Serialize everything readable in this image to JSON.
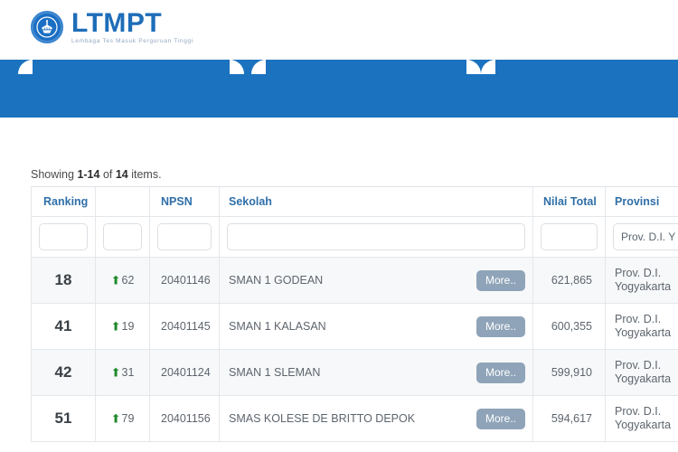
{
  "brand": {
    "name": "LTMPT",
    "tagline": "Lembaga Tes Masuk Perguruan Tinggi",
    "logo_icon": "university-emblem-icon",
    "accent_color": "#1e6db8",
    "navbar_color": "#1b72bf"
  },
  "summary": {
    "prefix": "Showing ",
    "range": "1-14",
    "middle": " of ",
    "total": "14",
    "suffix": " items."
  },
  "table": {
    "columns": [
      {
        "key": "ranking",
        "label": "Ranking"
      },
      {
        "key": "delta",
        "label": ""
      },
      {
        "key": "npsn",
        "label": "NPSN"
      },
      {
        "key": "sekolah",
        "label": "Sekolah"
      },
      {
        "key": "nilai_total",
        "label": "Nilai Total"
      },
      {
        "key": "provinsi",
        "label": "Provinsi"
      }
    ],
    "filters": {
      "ranking": "",
      "delta": "",
      "npsn": "",
      "sekolah": "",
      "nilai_total": "",
      "provinsi": "Prov. D.I. Y"
    },
    "more_label": "More..",
    "delta_icon": "arrow-up-icon",
    "delta_color": "#1d8a2b",
    "rows": [
      {
        "ranking": "18",
        "delta": "62",
        "npsn": "20401146",
        "sekolah": "SMAN 1 GODEAN",
        "nilai_total": "621,865",
        "prov_line1": "Prov. D.I.",
        "prov_line2": "Yogyakarta"
      },
      {
        "ranking": "41",
        "delta": "19",
        "npsn": "20401145",
        "sekolah": "SMAN 1 KALASAN",
        "nilai_total": "600,355",
        "prov_line1": "Prov. D.I.",
        "prov_line2": "Yogyakarta"
      },
      {
        "ranking": "42",
        "delta": "31",
        "npsn": "20401124",
        "sekolah": "SMAN 1 SLEMAN",
        "nilai_total": "599,910",
        "prov_line1": "Prov. D.I.",
        "prov_line2": "Yogyakarta"
      },
      {
        "ranking": "51",
        "delta": "79",
        "npsn": "20401156",
        "sekolah": "SMAS KOLESE DE BRITTO DEPOK",
        "nilai_total": "594,617",
        "prov_line1": "Prov. D.I.",
        "prov_line2": "Yogyakarta"
      }
    ]
  }
}
